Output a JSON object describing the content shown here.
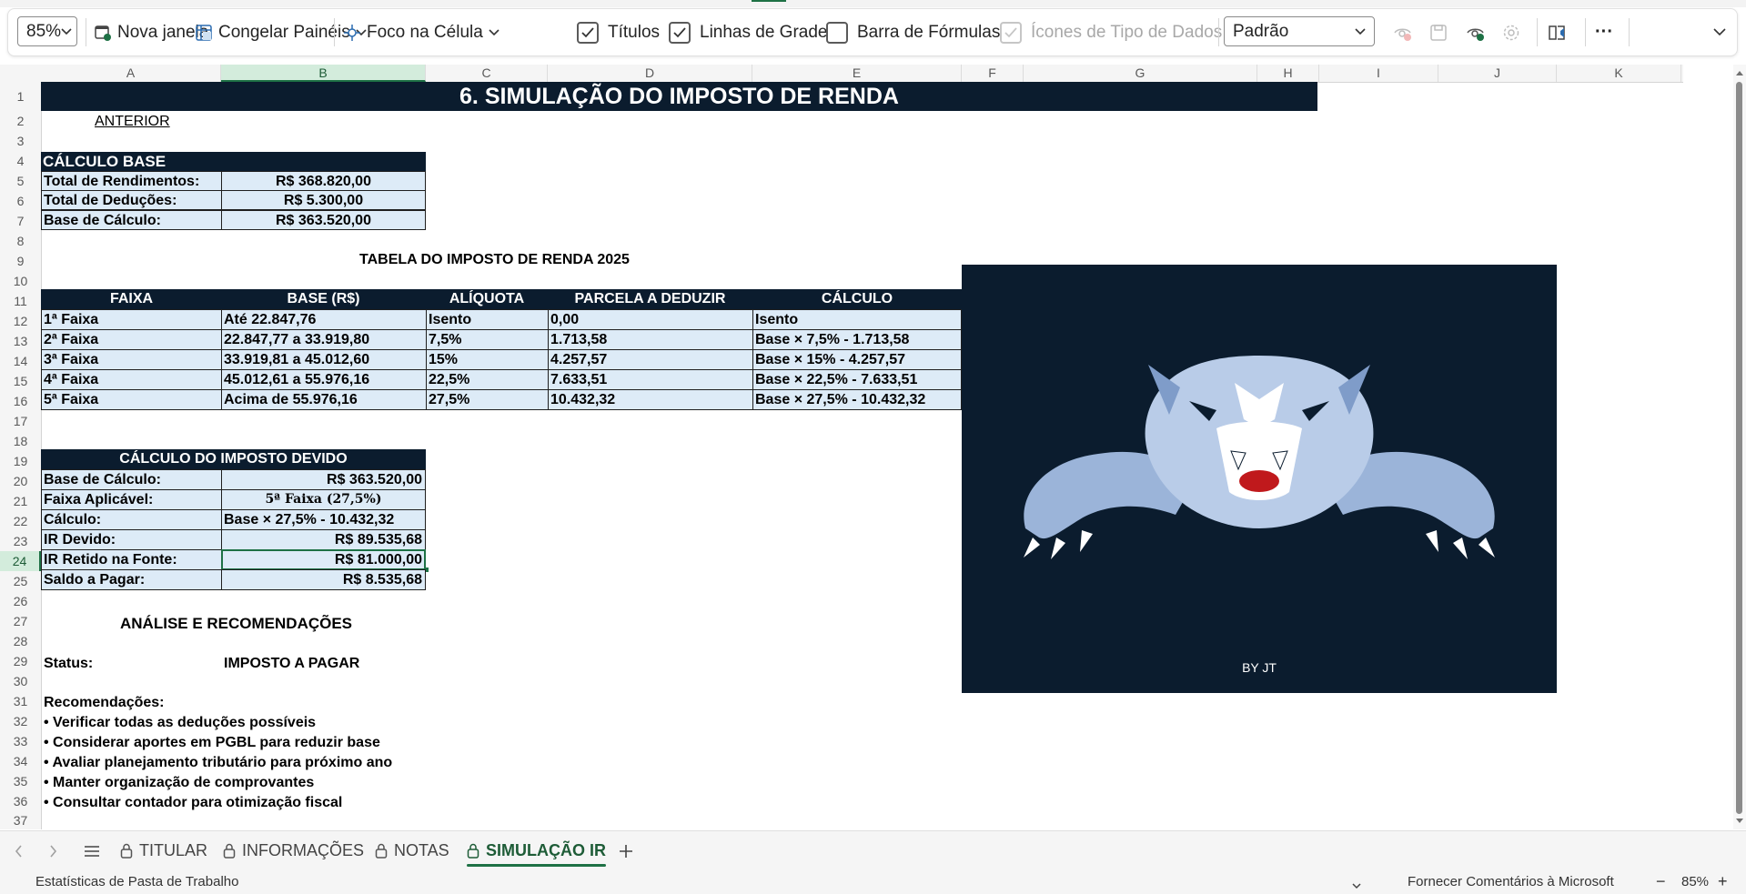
{
  "ribbon": {
    "zoom_value": "85%",
    "new_window": "Nova janela",
    "freeze_panes": "Congelar Painéis",
    "cell_focus": "Foco na Célula",
    "headings": "Títulos",
    "gridlines": "Linhas de Grade",
    "formula_bar": "Barra de Fórmulas",
    "data_type_icons": "Ícones de Tipo de Dados",
    "view_style": "Padrão",
    "more": "···"
  },
  "grid": {
    "columns": [
      "A",
      "B",
      "C",
      "D",
      "E",
      "F",
      "G",
      "H",
      "I",
      "J",
      "K"
    ],
    "rows": [
      "1",
      "2",
      "3",
      "4",
      "5",
      "6",
      "7",
      "8",
      "9",
      "10",
      "11",
      "12",
      "13",
      "14",
      "15",
      "16",
      "17",
      "18",
      "19",
      "20",
      "21",
      "22",
      "23",
      "24",
      "25",
      "26",
      "27",
      "28",
      "29",
      "30",
      "31",
      "32",
      "33",
      "34",
      "35",
      "36",
      "37"
    ],
    "selected_column": "B",
    "selected_row": "24"
  },
  "sheet": {
    "title": "6. SIMULAÇÃO DO IMPOSTO DE RENDA",
    "prev_link": "ANTERIOR",
    "base": {
      "header": "CÁLCULO BASE",
      "rows": [
        {
          "label": "Total de Rendimentos:",
          "value": "R$ 368.820,00"
        },
        {
          "label": "Total de Deduções:",
          "value": "R$ 5.300,00"
        },
        {
          "label": "Base de Cálculo:",
          "value": "R$ 363.520,00"
        }
      ]
    },
    "table_title": "TABELA DO IMPOSTO DE RENDA 2025",
    "tax_table": {
      "headers": [
        "FAIXA",
        "BASE (R$)",
        "ALÍQUOTA",
        "PARCELA A DEDUZIR",
        "CÁLCULO"
      ],
      "rows": [
        [
          "1ª Faixa",
          "Até 22.847,76",
          "Isento",
          "0,00",
          "Isento"
        ],
        [
          "2ª Faixa",
          "22.847,77 a 33.919,80",
          "7,5%",
          "1.713,58",
          "Base × 7,5% - 1.713,58"
        ],
        [
          "3ª Faixa",
          "33.919,81 a 45.012,60",
          "15%",
          "4.257,57",
          "Base × 15% - 4.257,57"
        ],
        [
          "4ª Faixa",
          "45.012,61 a 55.976,16",
          "22,5%",
          "7.633,51",
          "Base × 22,5% - 7.633,51"
        ],
        [
          "5ª Faixa",
          "Acima de 55.976,16",
          "27,5%",
          "10.432,32",
          "Base × 27,5% - 10.432,32"
        ]
      ]
    },
    "due": {
      "header": "CÁLCULO DO IMPOSTO DEVIDO",
      "rows": [
        {
          "label": "Base de Cálculo:",
          "value": "R$ 363.520,00"
        },
        {
          "label": "Faixa Aplicável:",
          "value": "5ª Faixa (27,5%)"
        },
        {
          "label": "Cálculo:",
          "value": "Base × 27,5% - 10.432,32"
        },
        {
          "label": "IR Devido:",
          "value": "R$ 89.535,68"
        },
        {
          "label": "IR Retido na Fonte:",
          "value": "R$ 81.000,00"
        },
        {
          "label": "Saldo a Pagar:",
          "value": "R$ 8.535,68"
        }
      ]
    },
    "analysis_title": "ANÁLISE E RECOMENDAÇÕES",
    "status_label": "Status:",
    "status_value": "IMPOSTO A PAGAR",
    "recommendations_title": "Recomendações:",
    "recommendations": [
      "• Verificar todas as deduções possíveis",
      "• Considerar aportes em PGBL para reduzir base",
      "• Avaliar planejamento tributário para próximo ano",
      "• Manter organização de comprovantes",
      "• Consultar contador para otimização fiscal"
    ],
    "image_caption": "BY JT"
  },
  "tabs": [
    "TITULAR",
    "INFORMAÇÕES",
    "NOTAS",
    "SIMULAÇÃO IR"
  ],
  "status": {
    "workbook_stats": "Estatísticas de Pasta de Trabalho",
    "feedback": "Fornecer Comentários à Microsoft",
    "zoom": "85%"
  },
  "colors": {
    "accent": "#1e7145",
    "header_dark": "#0b1c2e",
    "cell_light": "#ddebf7"
  }
}
